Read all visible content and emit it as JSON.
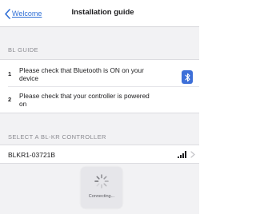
{
  "nav": {
    "back_label": "Welcome",
    "title": "Installation guide"
  },
  "guide": {
    "header": "BL GUIDE",
    "steps": [
      {
        "number": "1",
        "text": "Please check that Bluetooth is ON on your device",
        "icon": "bluetooth-icon"
      },
      {
        "number": "2",
        "text": "Please check that your controller is powered on"
      }
    ]
  },
  "controllers": {
    "header": "SELECT A BL-KR CONTROLLER",
    "items": [
      {
        "name": "BLKR1-03721B",
        "signal_icon": "signal-strength-icon"
      }
    ]
  },
  "status": {
    "text": "Connecting..."
  },
  "colors": {
    "accent": "#2f6fd6",
    "bluetooth_badge": "#3d6fd8",
    "background": "#f2f2f4"
  }
}
